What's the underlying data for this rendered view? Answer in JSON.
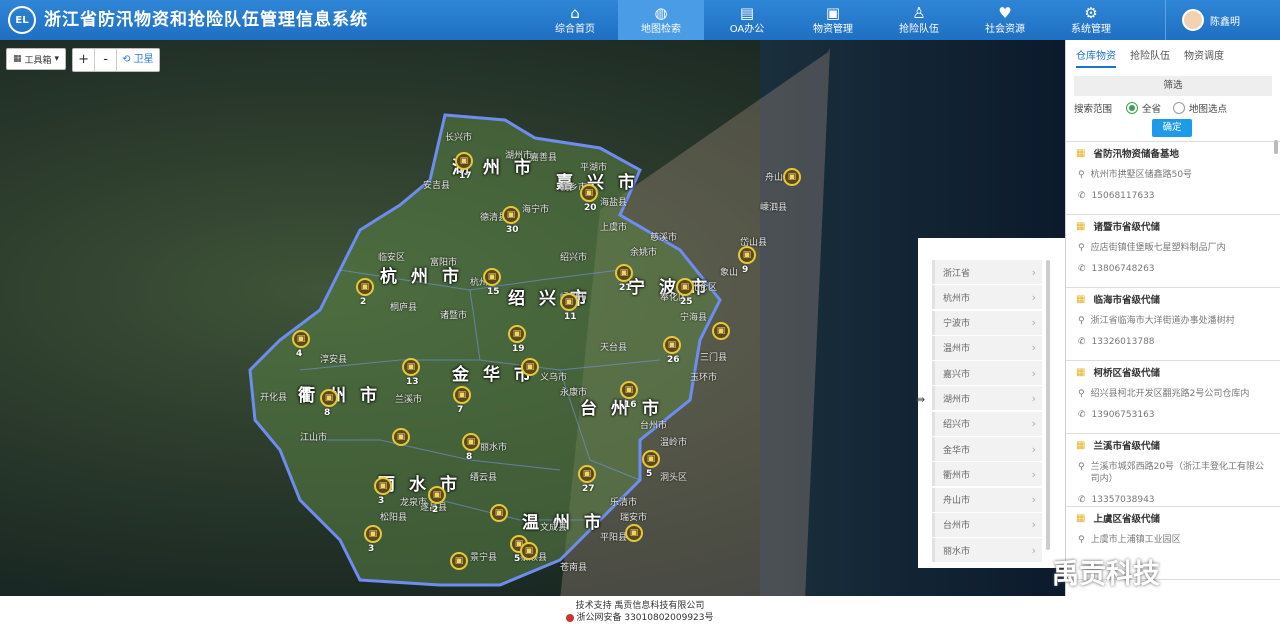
{
  "header": {
    "logo_text": "EL",
    "title": "浙江省防汛物资和抢险队伍管理信息系统",
    "nav": [
      {
        "label": "综合首页",
        "icon": "home-icon",
        "glyph": "⌂"
      },
      {
        "label": "地图检索",
        "icon": "globe-icon",
        "glyph": "◍"
      },
      {
        "label": "OA办公",
        "icon": "book-icon",
        "glyph": "▤"
      },
      {
        "label": "物资管理",
        "icon": "briefcase-icon",
        "glyph": "▣"
      },
      {
        "label": "抢险队伍",
        "icon": "sitemap-icon",
        "glyph": "♙"
      },
      {
        "label": "社会资源",
        "icon": "heart-icon",
        "glyph": "♥"
      },
      {
        "label": "系统管理",
        "icon": "gear-icon",
        "glyph": "⚙"
      }
    ],
    "active_nav": "地图检索",
    "user_name": "陈鑫明"
  },
  "map": {
    "toolbar_label": "工具箱",
    "zoom_in": "+",
    "zoom_out": "-",
    "satellite_label": "卫星",
    "city_labels": [
      "湖州市",
      "嘉兴市",
      "杭州市",
      "绍兴市",
      "宁波市",
      "金华市",
      "衢州市",
      "台州市",
      "丽水市",
      "温州市"
    ],
    "county_labels": [
      "长兴市",
      "湖州市",
      "安吉县",
      "桐乡市",
      "海宁市",
      "临安区",
      "富阳市",
      "诸暨市",
      "绍兴市",
      "象山",
      "义乌市",
      "永康市",
      "丽水市",
      "台州市",
      "乐清市",
      "文成县",
      "泰顺县",
      "温岭市",
      "龙泉市",
      "江山市",
      "兰溪市",
      "开化县",
      "淳安县",
      "桐庐县",
      "上虞市",
      "余姚市",
      "慈溪市",
      "嵊州市",
      "天台县",
      "缙云县",
      "遂昌县",
      "松阳县",
      "景宁县",
      "苍南县",
      "平阳县",
      "瑞安市",
      "洞头区",
      "玉环市",
      "三门县",
      "宁海县",
      "奉化区",
      "北仑区",
      "舟山市",
      "岱山县",
      "嵊泗县",
      "平湖市",
      "海盐县",
      "嘉善县",
      "德清县",
      "杭州市"
    ],
    "marker_counts": [
      "17",
      "30",
      "20",
      "2",
      "15",
      "21",
      "25",
      "9",
      "4",
      "11",
      "19",
      "13",
      "26",
      "8",
      "7",
      "16",
      "8",
      "5",
      "3",
      "2",
      "27",
      "3",
      "5"
    ]
  },
  "city_list": [
    "浙江省",
    "杭州市",
    "宁波市",
    "温州市",
    "嘉兴市",
    "湖州市",
    "绍兴市",
    "金华市",
    "衢州市",
    "舟山市",
    "台州市",
    "丽水市"
  ],
  "right_panel": {
    "tabs": [
      "仓库物资",
      "抢险队伍",
      "物资调度"
    ],
    "active_tab": "仓库物资",
    "filter_title": "筛选",
    "scope_label": "搜索范围",
    "scope_options": [
      "全省",
      "地图选点"
    ],
    "scope_selected": "全省",
    "confirm_label": "确定",
    "depots": [
      {
        "name": "省防汛物资储备基地",
        "address": "杭州市拱墅区储鑫路50号",
        "phone": "15068117633"
      },
      {
        "name": "诸暨市省级代储",
        "address": "应店街镇佳堡畈七星塑料制品厂内",
        "phone": "13806748263"
      },
      {
        "name": "临海市省级代储",
        "address": "浙江省临海市大洋街道办事处潘树村",
        "phone": "13326013788"
      },
      {
        "name": "柯桥区省级代储",
        "address": "绍兴县柯北开发区翻兆路2号公司仓库内",
        "phone": "13906753163"
      },
      {
        "name": "兰溪市省级代储",
        "address": "兰溪市城郊西路20号（浙江丰登化工有限公司内）",
        "phone": "13357038943"
      },
      {
        "name": "上虞区省级代储",
        "address": "上虞市上浦镇工业园区",
        "phone": ""
      }
    ]
  },
  "watermark": "禹贡科技",
  "footer": {
    "support": "技术支持 禹贡信息科技有限公司",
    "icp": "浙公网安备 33010802009923号"
  },
  "colors": {
    "header_bg": "#1f6fc3",
    "active_nav_bg": "#4a9ce6",
    "accent": "#1e73c8",
    "marker_ring": "#e6c83a",
    "boundary": "#6f8cf0"
  }
}
